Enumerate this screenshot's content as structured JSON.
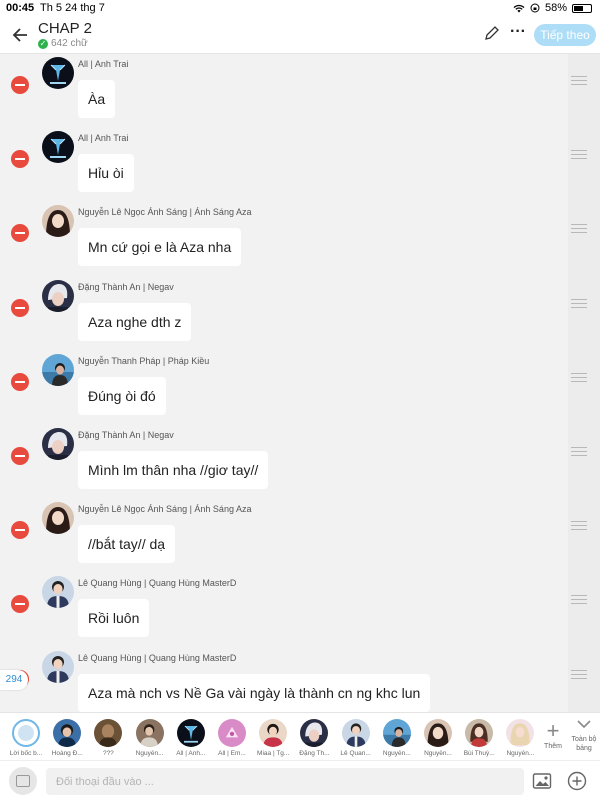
{
  "status_bar": {
    "time": "00:45",
    "date": "Th 5 24 thg 7",
    "battery": "58%",
    "battery_level": 0.58
  },
  "header": {
    "title": "CHAP 2",
    "word_count": "642 chữ",
    "continue_label": "Tiếp theo"
  },
  "colors": {
    "accent": "#aeddf7",
    "remove": "#e84a3e",
    "check": "#2bb24c",
    "count": "#2c8fd6"
  },
  "messages": [
    {
      "author": "All | Anh Trai",
      "text": "Àa",
      "avatar": "anh-trai-logo"
    },
    {
      "author": "All | Anh Trai",
      "text": "Hỉu òi",
      "avatar": "anh-trai-logo"
    },
    {
      "author": "Nguyễn Lê Ngọc Ánh Sáng | Ánh Sáng Aza",
      "text": "Mn cứ gọi e là Aza nha",
      "avatar": "anh-sang-aza"
    },
    {
      "author": "Đặng Thành An | Negav",
      "text": "Aza nghe dth z",
      "avatar": "negav"
    },
    {
      "author": "Nguyễn Thanh Pháp | Pháp Kiều",
      "text": "Đúng òi đó",
      "avatar": "phap-kieu"
    },
    {
      "author": "Đặng Thành An | Negav",
      "text": "Mình lm thân nha //giơ tay//",
      "avatar": "negav"
    },
    {
      "author": "Nguyễn Lê Ngọc Ánh Sáng | Ánh Sáng Aza",
      "text": "//bắt tay// dạ",
      "avatar": "anh-sang-aza"
    },
    {
      "author": "Lê Quang Hùng | Quang Hùng MasterD",
      "text": "Rồi luôn",
      "avatar": "quang-hung"
    },
    {
      "author": "Lê Quang Hùng | Quang Hùng MasterD",
      "text": "Aza mà nch vs Nề Ga vài ngày là thành cn ng khc lun",
      "avatar": "quang-hung"
    }
  ],
  "message_count": "294",
  "characters": [
    {
      "name": "Lời bốc b...",
      "avatar": "narrator"
    },
    {
      "name": "Hoàng Đ...",
      "avatar": "hoang-d"
    },
    {
      "name": "???",
      "avatar": "unknown"
    },
    {
      "name": "Nguyễn...",
      "avatar": "nguyen-1"
    },
    {
      "name": "All | Anh...",
      "avatar": "anh-trai-logo"
    },
    {
      "name": "All | Em...",
      "avatar": "em-xinh"
    },
    {
      "name": "Miaa | Tg...",
      "avatar": "miaa"
    },
    {
      "name": "Đặng Th...",
      "avatar": "negav"
    },
    {
      "name": "Lê Quan...",
      "avatar": "quang-hung"
    },
    {
      "name": "Nguyễn...",
      "avatar": "phap-kieu"
    },
    {
      "name": "Nguyễn...",
      "avatar": "anh-sang-aza"
    },
    {
      "name": "Bùi Thuỳ...",
      "avatar": "bui-thuy"
    },
    {
      "name": "Nguyễn...",
      "avatar": "nguyen-2"
    }
  ],
  "add_character_label": "Thêm",
  "all_scenes_label": "Toàn bộ bảng",
  "input": {
    "placeholder": "Đối thoại đầu vào ..."
  }
}
